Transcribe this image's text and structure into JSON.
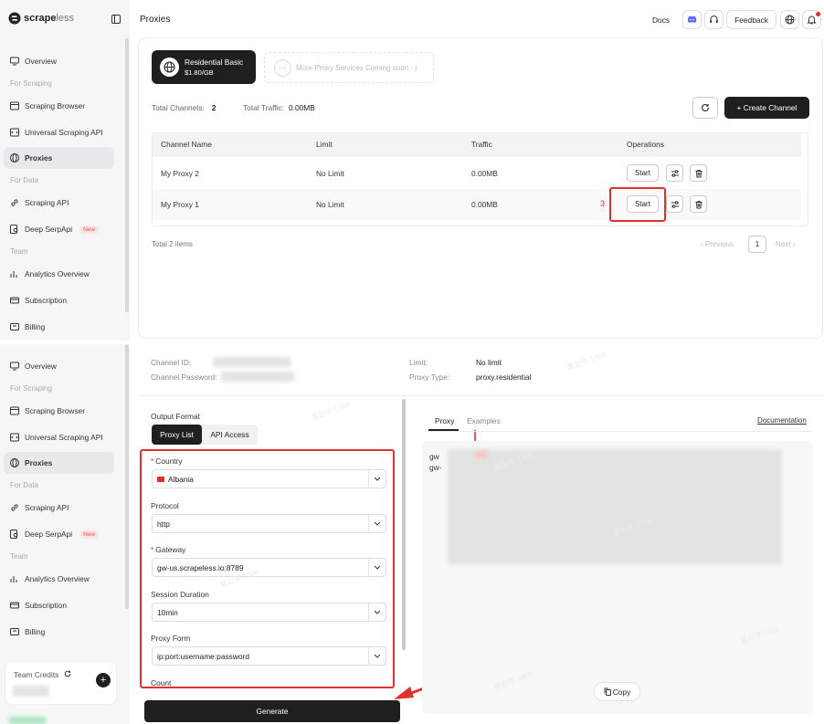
{
  "brand": {
    "name_prefix": "scrape",
    "name_suffix": "less"
  },
  "sidebar": {
    "overview": "Overview",
    "sec_scraping": "For Scraping",
    "scraping_browser": "Scraping Browser",
    "universal_api": "Universal Scraping API",
    "proxies": "Proxies",
    "sec_data": "For Data",
    "scraping_api": "Scraping API",
    "deep_serpapi": "Deep SerpApi",
    "new_badge": "New",
    "sec_team": "Team",
    "analytics": "Analytics Overview",
    "subscription": "Subscription",
    "billing": "Billing",
    "team_credits": "Team Credits"
  },
  "header": {
    "title": "Proxies",
    "docs": "Docs",
    "feedback": "Feedback"
  },
  "proxy_card": {
    "name": "Residential Basic",
    "price": "$1.80/GB",
    "coming_soon": "More Proxy Services Coming soon : )"
  },
  "stats": {
    "channels_label": "Total Channels:",
    "channels_value": "2",
    "traffic_label": "Total Traffic:",
    "traffic_value": "0.00MB"
  },
  "create_channel": "+ Create Channel",
  "table": {
    "headers": [
      "Channel Name",
      "Limit",
      "Traffic",
      "Operations"
    ],
    "rows": [
      {
        "name": "My Proxy 2",
        "limit": "No Limit",
        "traffic": "0.00MB",
        "action": "Start"
      },
      {
        "name": "My Proxy 1",
        "limit": "No Limit",
        "traffic": "0.00MB",
        "action": "Start"
      }
    ]
  },
  "step_number": "3",
  "pagination": {
    "total": "Total 2 items",
    "prev": "‹ Previous",
    "page": "1",
    "next": "Next ›"
  },
  "channel_info": {
    "id_label": "Channel ID:",
    "password_label": "Channel Password:",
    "limit_label": "Limit:",
    "limit_value": "No limit",
    "type_label": "Proxy Type:",
    "type_value": "proxy.residential"
  },
  "form": {
    "output_format": "Output Format",
    "tab_list": "Proxy List",
    "tab_api": "API Access",
    "country_label": "Country",
    "country_value": "Albania",
    "protocol_label": "Protocol",
    "protocol_value": "http",
    "gateway_label": "Gateway",
    "gateway_value": "gw-us.scrapeless.io:8789",
    "session_label": "Session Duration",
    "session_value": "10min",
    "form_label": "Proxy Form",
    "form_value": "ip:port:username:password",
    "count_label": "Count",
    "generate": "Generate"
  },
  "output": {
    "tab_proxy": "Proxy",
    "tab_examples": "Examples",
    "documentation": "Documentation",
    "line1": "gw",
    "line2": "gw-",
    "copy": "Copy"
  },
  "watermark": "葛赵宇 1368",
  "colors": {
    "accent_red": "#e0312e",
    "dark": "#1c1c1c",
    "new_badge": "#e85a55"
  }
}
